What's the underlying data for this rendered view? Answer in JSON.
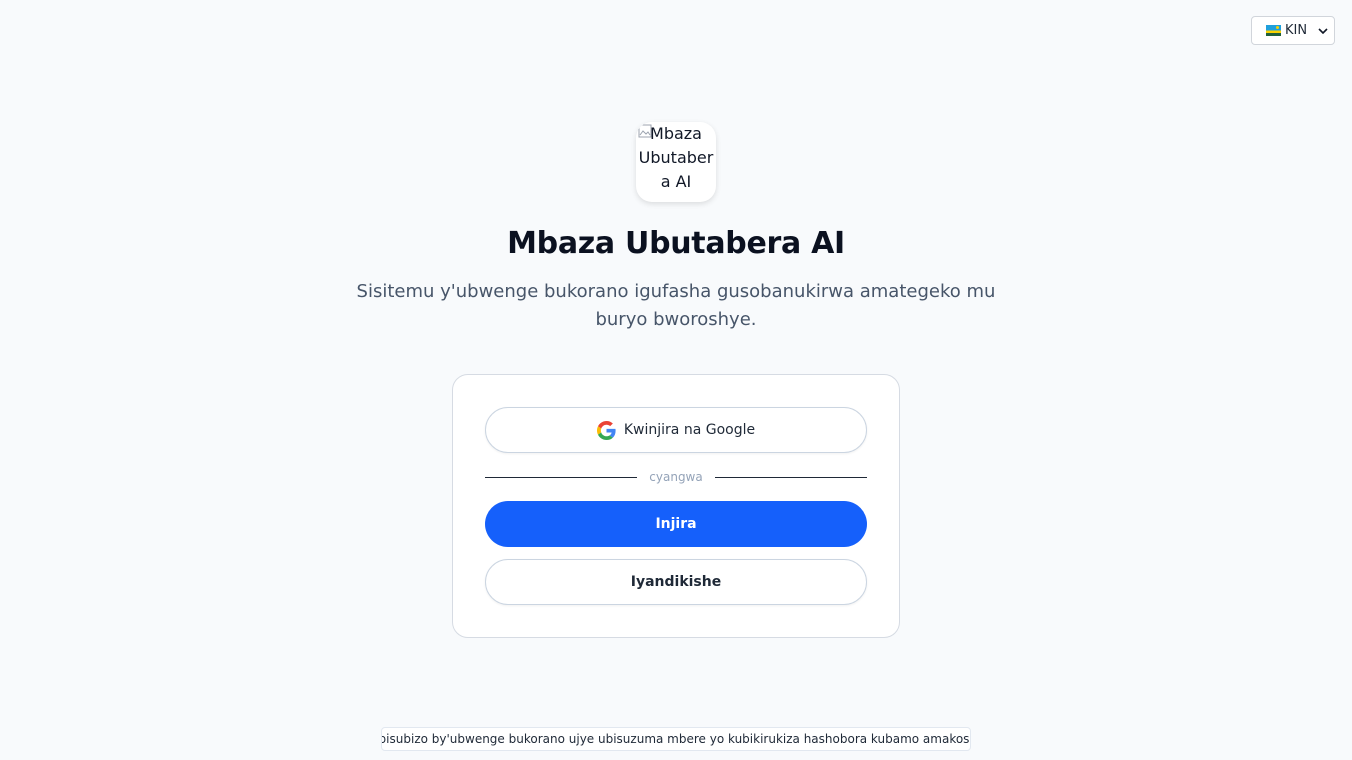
{
  "language_selector": {
    "selected": "KIN",
    "flag_icon": "rwanda-flag-icon"
  },
  "logo": {
    "alt_text": "Mbaza Ubutabera AI"
  },
  "header": {
    "title": "Mbaza Ubutabera AI",
    "subtitle": "Sisitemu y'ubwenge bukorano igufasha gusobanukirwa amategeko mu buryo bworoshye."
  },
  "auth": {
    "google_label": "Kwinjira na Google",
    "divider_text": "cyangwa",
    "login_label": "Injira",
    "register_label": "Iyandikishe"
  },
  "footer": {
    "disclaimer": "ibisubizo by'ubwenge bukorano ujye ubisuzuma mbere yo kubikirukiza hashobora kubamo amakosa"
  },
  "colors": {
    "primary": "#1560fb",
    "background": "#f8fafc",
    "title": "#0b1120",
    "subtitle": "#475569"
  }
}
